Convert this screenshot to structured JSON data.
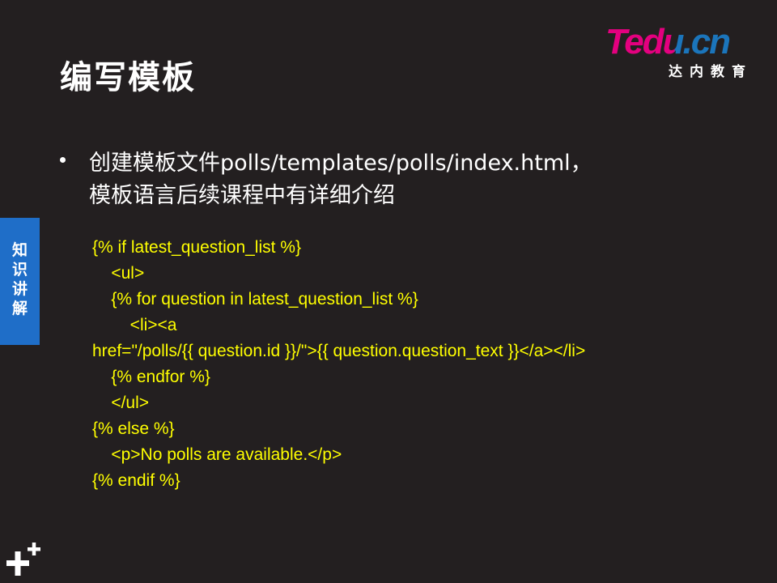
{
  "slide": {
    "title": "编写模板",
    "logo": {
      "brand": "Tedu.cn",
      "subtitle": "达内教育"
    },
    "side_tab": {
      "chars": [
        "知",
        "识",
        "讲",
        "解"
      ]
    },
    "bullet": {
      "lines": [
        "创建模板文件polls/templates/polls/index.html，",
        "模板语言后续课程中有详细介绍"
      ]
    },
    "code": {
      "lines": [
        "{% if latest_question_list %}",
        "    <ul>",
        "    {% for question in latest_question_list %}",
        "        <li><a",
        "href=\"/polls/{{ question.id }}/\">{{ question.question_text }}</a></li>",
        "    {% endfor %}",
        "    </ul>",
        "{% else %}",
        "    <p>No polls are available.</p>",
        "{% endif %}"
      ]
    },
    "colors": {
      "background": "#231f20",
      "code_text": "#ffff00",
      "side_tab": "#1f6ec8",
      "logo_magenta": "#e4007f",
      "logo_blue": "#1b75bb"
    },
    "icons": {
      "corner_mark": "plus-cross-icon"
    }
  }
}
